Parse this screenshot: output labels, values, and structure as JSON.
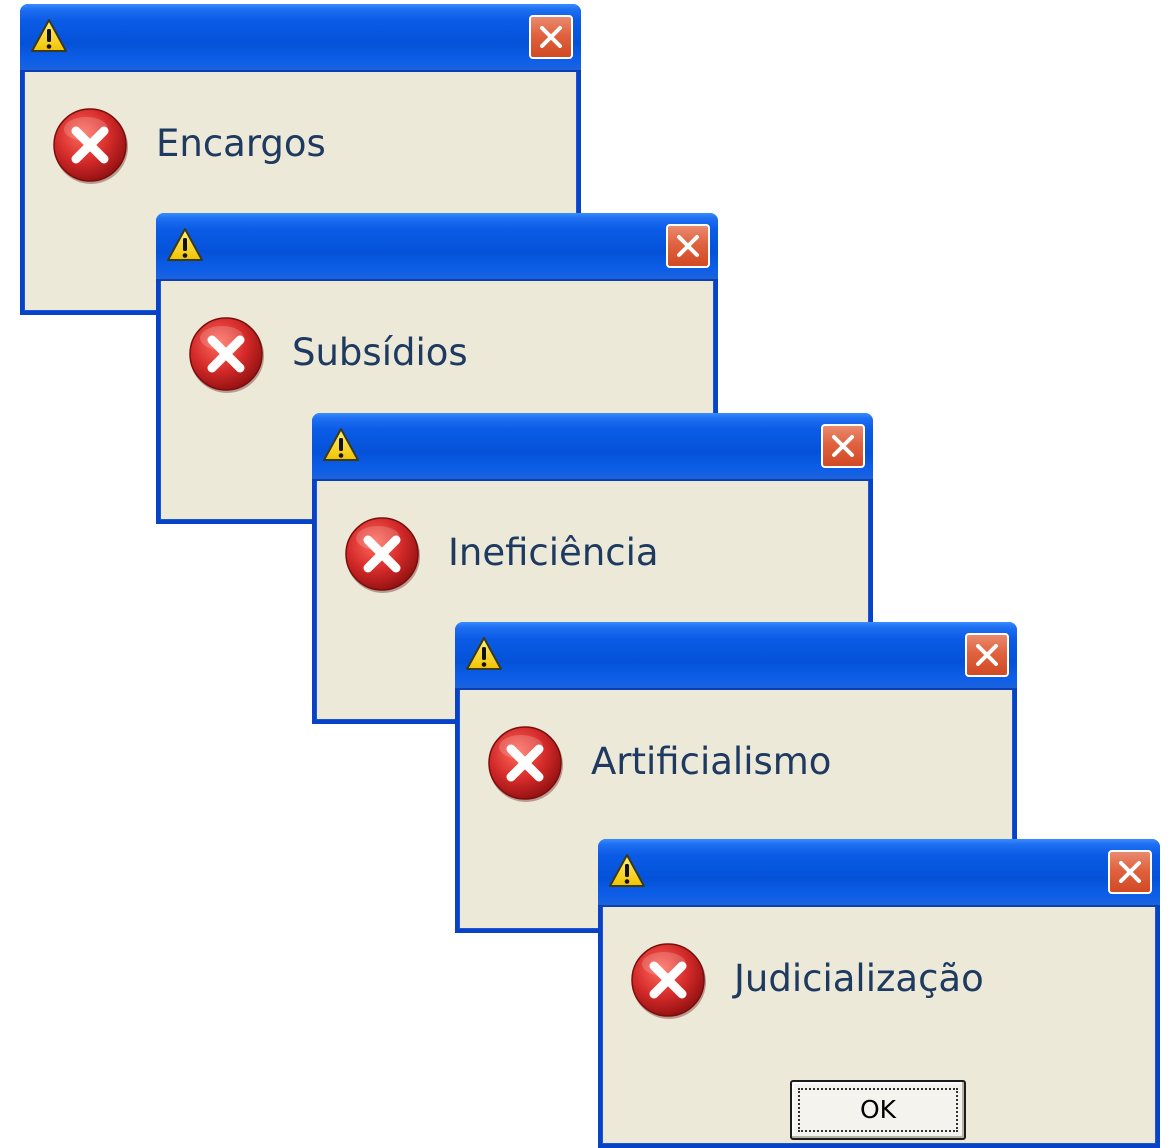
{
  "dialogs": [
    {
      "message": "Encargos",
      "title_icon": "warning-icon",
      "body_icon": "error-icon"
    },
    {
      "message": "Subsídios",
      "title_icon": "warning-icon",
      "body_icon": "error-icon"
    },
    {
      "message": "Ineficiência",
      "title_icon": "warning-icon",
      "body_icon": "error-icon"
    },
    {
      "message": "Artificialismo",
      "title_icon": "warning-icon",
      "body_icon": "error-icon"
    },
    {
      "message": "Judicialização",
      "title_icon": "warning-icon",
      "body_icon": "error-icon",
      "ok_label": "OK"
    }
  ],
  "colors": {
    "titlebar": "#0552d9",
    "body": "#ece9d8",
    "close": "#e0623f",
    "error": "#d42a2a",
    "warning": "#f7d117"
  }
}
